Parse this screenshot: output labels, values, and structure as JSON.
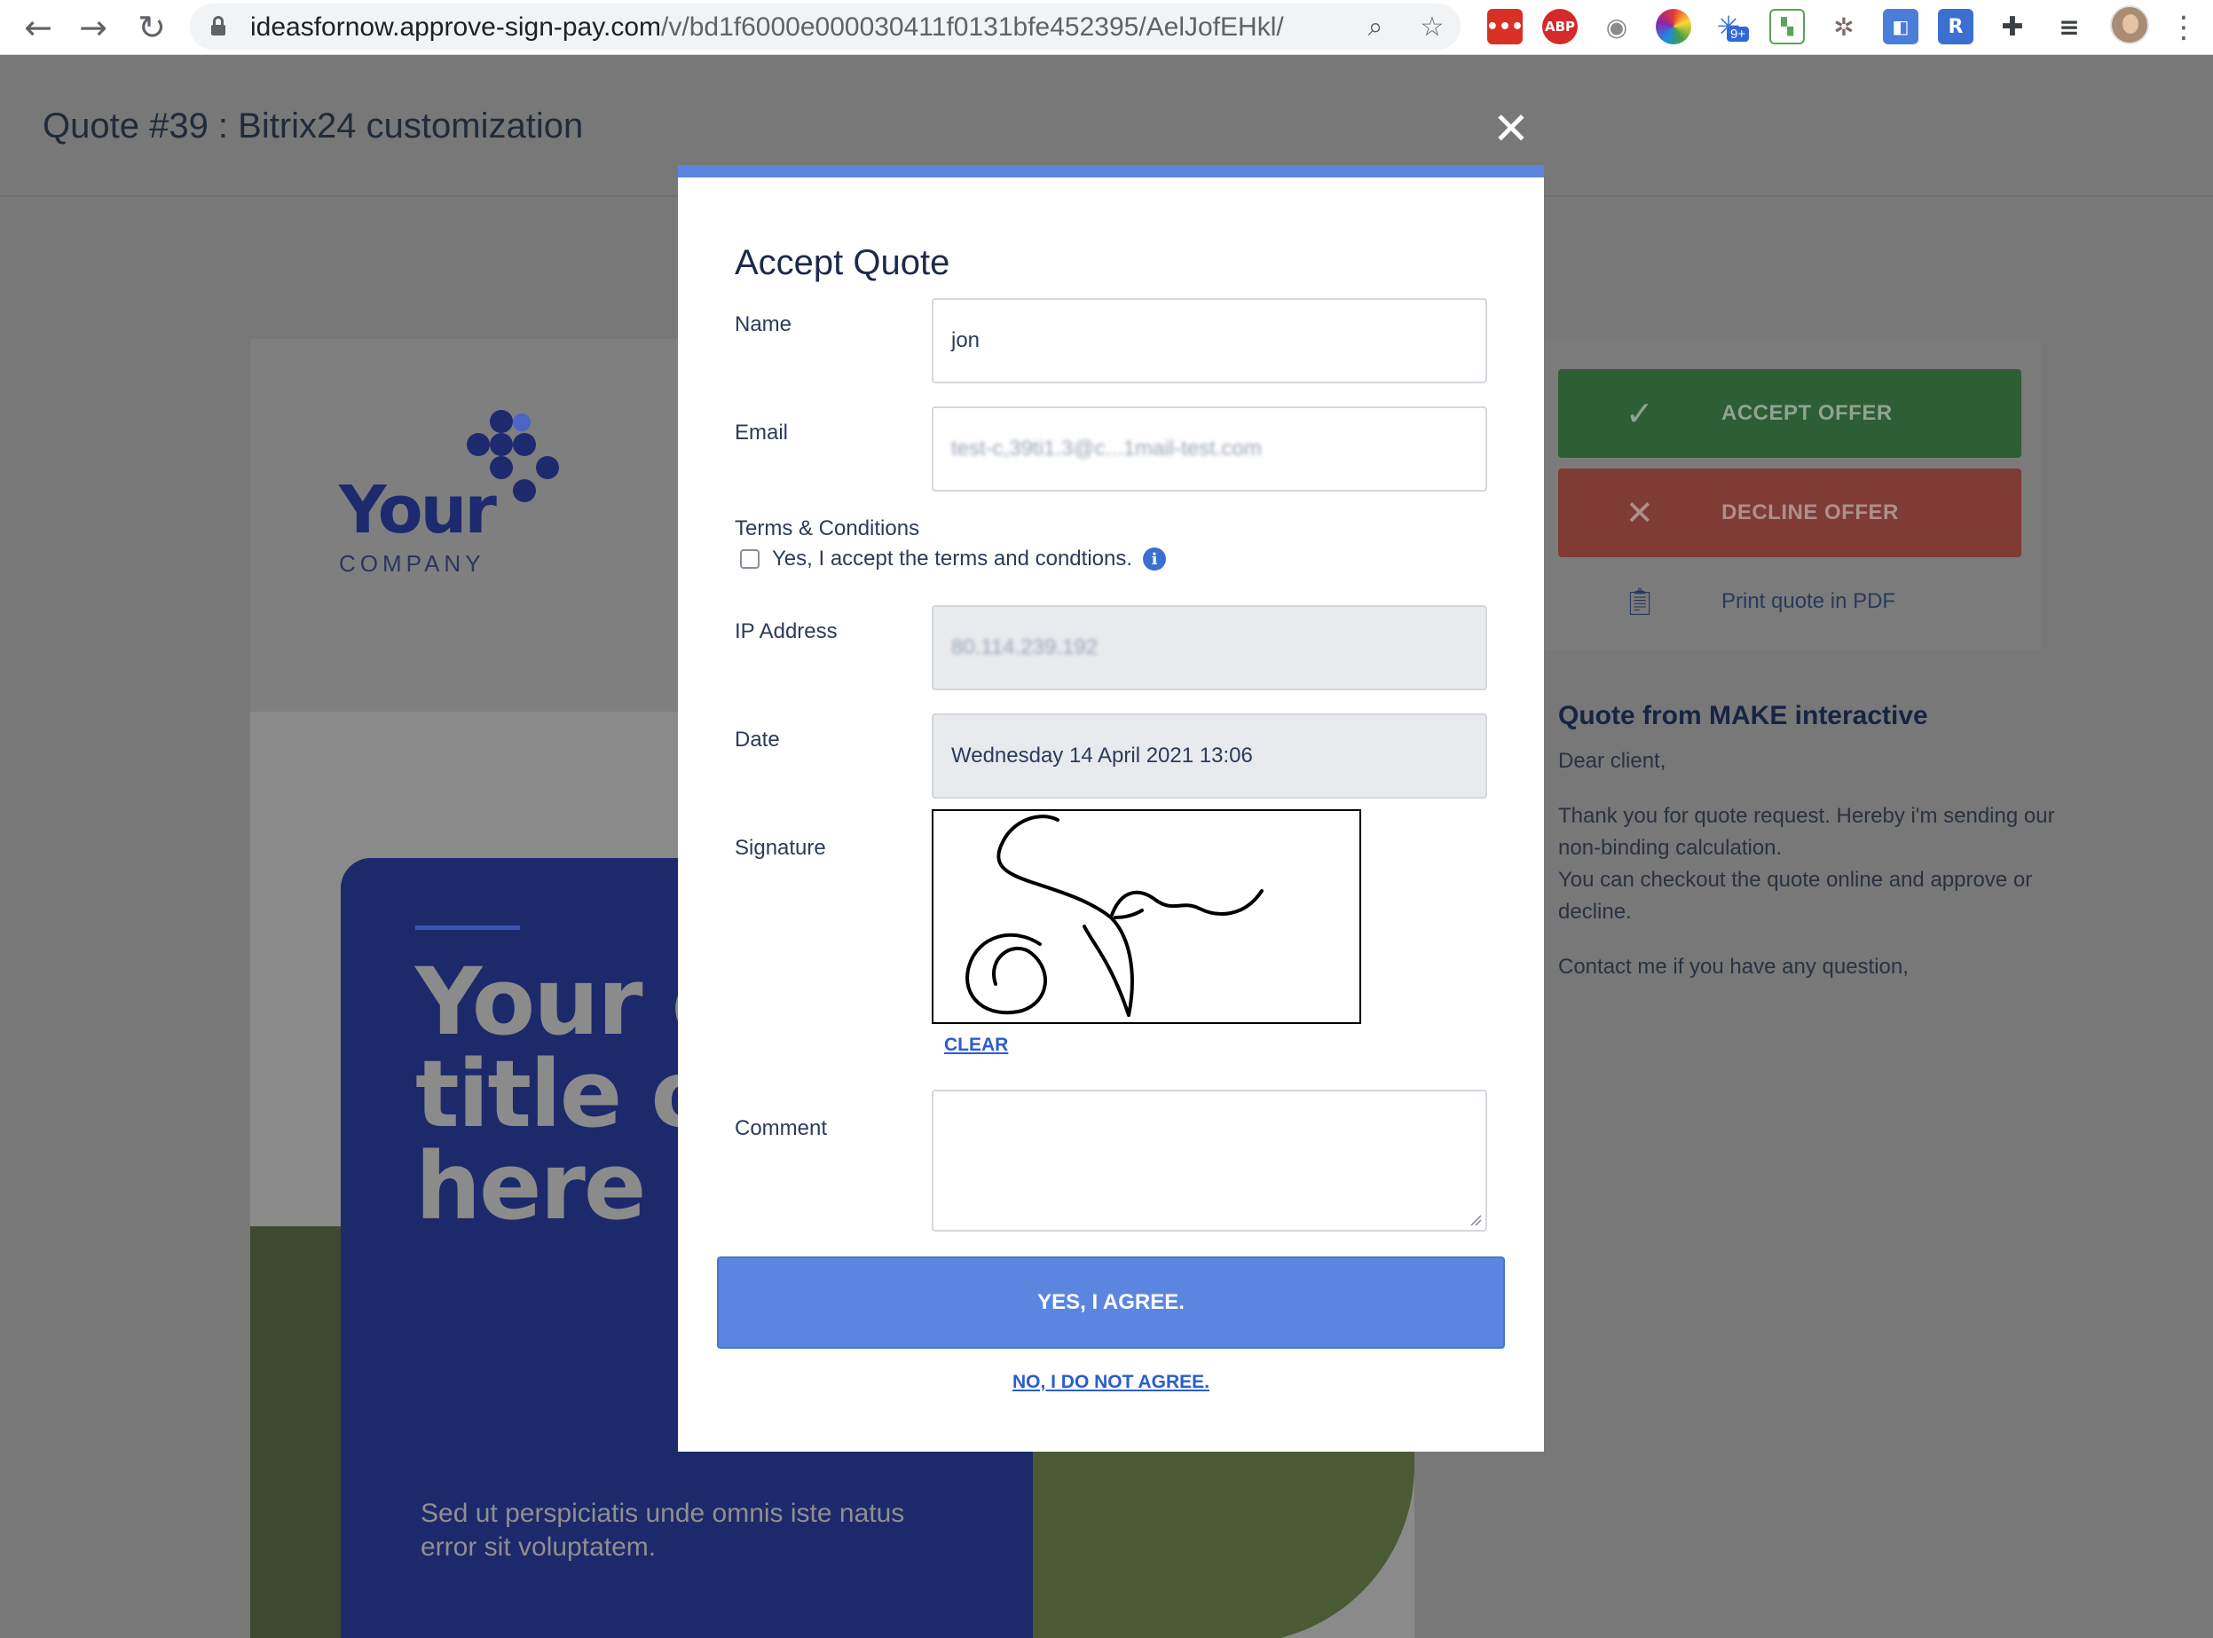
{
  "browser": {
    "url_domain": "ideasfornow.approve-sign-pay.com",
    "url_path": "/v/bd1f6000e000030411f0131bfe452395/AelJofEHkl/",
    "extension_badge": "9+",
    "ext_abp_label": "ABP",
    "ext_r_label": "R"
  },
  "page": {
    "title": "Quote #39 : Bitrix24 customization"
  },
  "document": {
    "logo_word": "Your",
    "logo_sub": "COMPANY",
    "hero_title": "Your o\ntitle o\nhere",
    "hero_subtitle": "Sed ut perspiciatis unde omnis iste natus error sit voluptatem."
  },
  "sidebar": {
    "accept_label": "ACCEPT OFFER",
    "decline_label": "DECLINE OFFER",
    "print_label": "Print quote in PDF",
    "accept_icon": "checkmark-icon",
    "decline_icon": "x-icon",
    "print_icon": "clipboard-icon"
  },
  "quote": {
    "heading": "Quote from MAKE interactive",
    "greeting": "Dear client,",
    "body_1": "Thank you for quote request. Hereby i'm sending our non-binding calculation.",
    "body_2": "You can checkout the quote online and approve or decline.",
    "closing": "Contact me if you have any question,"
  },
  "modal": {
    "title": "Accept Quote",
    "name_label": "Name",
    "name_value": "jon",
    "email_label": "Email",
    "email_value": "test-c,39ti1.3@c...1mail-test.com",
    "terms_label": "Terms & Conditions",
    "terms_checkbox_label": "Yes, I accept the terms and condtions.",
    "terms_checked": false,
    "ip_label": "IP Address",
    "ip_value": "80.114.239.192",
    "date_label": "Date",
    "date_value": "Wednesday 14 April 2021 13:06",
    "signature_label": "Signature",
    "clear_label": "CLEAR",
    "comment_label": "Comment",
    "comment_value": "",
    "agree_label": "YES, I AGREE.",
    "disagree_label": "NO, I DO NOT AGREE."
  },
  "colors": {
    "accent_blue": "#5b86e0",
    "link_blue": "#2a5dd0",
    "accept_green": "#2e5e33",
    "decline_red": "#7e3c35",
    "navy_text": "#1e2a4a"
  }
}
